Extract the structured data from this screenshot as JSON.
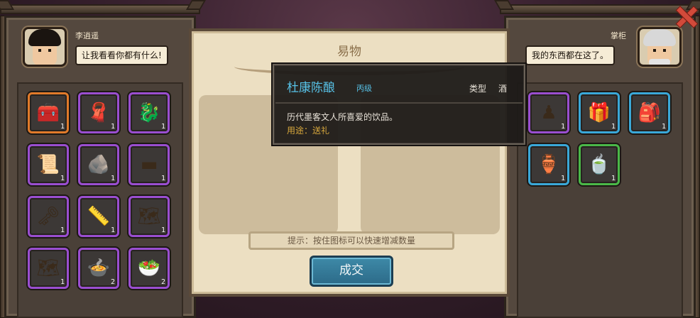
{
  "trade_panel": {
    "title": "易物",
    "hint": "提示：按住图标可以快速增减数量",
    "confirm_label": "成交"
  },
  "player": {
    "name": "李逍遥",
    "speech": "让我看看你都有什么!"
  },
  "merchant": {
    "name": "掌柜",
    "speech": "我的东西都在这了。"
  },
  "tooltip": {
    "item_name": "杜康陈酿",
    "grade": "丙级",
    "type_label": "类型",
    "type_value": "酒",
    "description": "历代墨客文人所喜爱的饮品。",
    "use": "用途：送礼"
  },
  "player_items": [
    {
      "icon": "treasure-chest-icon",
      "glyph": "🧰",
      "count": "1",
      "rarity_color": "#e07a2a"
    },
    {
      "icon": "silk-cloth-icon",
      "glyph": "🧣",
      "count": "1",
      "rarity_color": "#9a4ed0"
    },
    {
      "icon": "gold-ornament-icon",
      "glyph": "🐉",
      "count": "1",
      "rarity_color": "#9a4ed0"
    },
    {
      "icon": "tablet-icon",
      "glyph": "📜",
      "count": "1",
      "rarity_color": "#9a4ed0"
    },
    {
      "icon": "stone-icon",
      "glyph": "🪨",
      "count": "1",
      "rarity_color": "#9a4ed0"
    },
    {
      "icon": "iron-bar-icon",
      "glyph": "▬",
      "count": "1",
      "rarity_color": "#9a4ed0"
    },
    {
      "icon": "key-icon",
      "glyph": "🗝",
      "count": "1",
      "rarity_color": "#9a4ed0"
    },
    {
      "icon": "scroll-icon",
      "glyph": "📏",
      "count": "1",
      "rarity_color": "#9a4ed0"
    },
    {
      "icon": "map-icon",
      "glyph": "🗺",
      "count": "1",
      "rarity_color": "#9a4ed0"
    },
    {
      "icon": "map-icon",
      "glyph": "🗺",
      "count": "1",
      "rarity_color": "#9a4ed0"
    },
    {
      "icon": "dish-icon",
      "glyph": "🍲",
      "count": "2",
      "rarity_color": "#9a4ed0"
    },
    {
      "icon": "soup-bowl-icon",
      "glyph": "🥗",
      "count": "2",
      "rarity_color": "#9a4ed0"
    }
  ],
  "merchant_items": [
    {
      "icon": "jade-figure-icon",
      "glyph": "♟",
      "count": "1",
      "rarity_color": "#9a4ed0"
    },
    {
      "icon": "red-box-icon",
      "glyph": "🎁",
      "count": "1",
      "rarity_color": "#3aa8d8"
    },
    {
      "icon": "bundle-icon",
      "glyph": "🎒",
      "count": "1",
      "rarity_color": "#3aa8d8"
    },
    {
      "icon": "wine-jar-icon",
      "glyph": "🏺",
      "count": "1",
      "rarity_color": "#3aa8d8"
    },
    {
      "icon": "jade-cup-icon",
      "glyph": "🍵",
      "count": "1",
      "rarity_color": "#4ab848"
    }
  ]
}
